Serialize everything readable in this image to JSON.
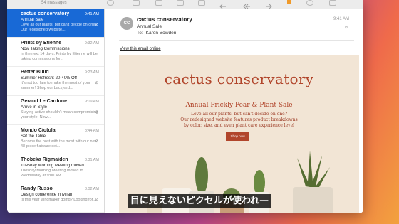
{
  "window": {
    "message_count": "54 messages"
  },
  "messages": [
    {
      "from": "cactus conservatory",
      "time": "9:41 AM",
      "subject": "Annual Sale",
      "preview": "Love all our plants, but can't decide on one? Our redesigned website...",
      "selected": true,
      "attachment": true
    },
    {
      "from": "Prints by Etienne",
      "time": "9:32 AM",
      "subject": "Now Taking Commissions",
      "preview": "In the next 14 days, Prints by Etienne will be taking commissions for...",
      "selected": false,
      "attachment": false
    },
    {
      "from": "Better Build",
      "time": "9:23 AM",
      "subject": "Summer Refresh: 20-40% Off",
      "preview": "It's not too late to make the most of your summer! Shop our backyard...",
      "selected": false,
      "attachment": true
    },
    {
      "from": "Geraud Le Cardune",
      "time": "9:09 AM",
      "subject": "Arrive in Style",
      "preview": "Staying active shouldn't mean compromising your style. Now...",
      "selected": false,
      "attachment": true
    },
    {
      "from": "Mondo Ciotola",
      "time": "8:44 AM",
      "subject": "Set the Table",
      "preview": "Become the host with the most with our new 48-piece flatware set...",
      "selected": false,
      "attachment": true
    },
    {
      "from": "Thobeka Rigmaiden",
      "time": "8:31 AM",
      "subject": "Tuesday Morning Meeting moved",
      "preview": "Tuesday Morning Meeting moved to Wednesday at 9:00 AM...",
      "selected": false,
      "attachment": false
    },
    {
      "from": "Randy Russo",
      "time": "8:02 AM",
      "subject": "Design conference in Milan",
      "preview": "Is this year windmaker doing? Looking for...",
      "selected": false,
      "attachment": true
    }
  ],
  "header": {
    "avatar_initials": "CC",
    "from": "cactus conservatory",
    "subject": "Annual Sale",
    "to_label": "To:",
    "to": "Karen Bowden",
    "time": "9:41 AM"
  },
  "view_online": "View this email online",
  "email": {
    "brand": "cactus conservatory",
    "announcement": "Annual Prickly Pear & Plant Sale",
    "copy_lines": [
      "Love all our plants, but can't decide on one?",
      "Our redesigned website features product breakdowns",
      "by color, size, and even plant care experience level"
    ],
    "button": "Shop now"
  },
  "subtitle": "目に見えないピクセルが使われ—",
  "colors": {
    "selection": "#1869d6",
    "brand": "#b1452b",
    "card": "#f2e5d5"
  }
}
